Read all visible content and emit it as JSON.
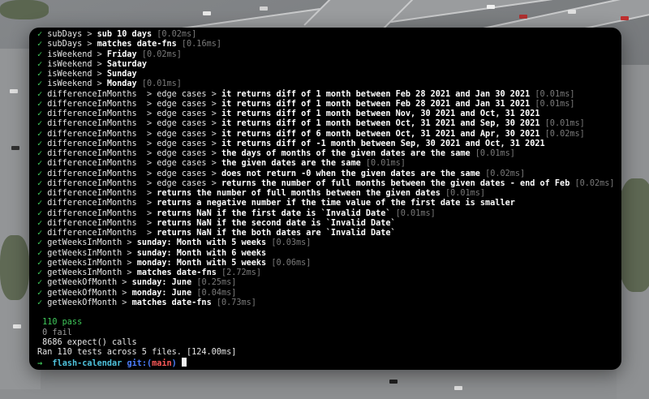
{
  "terminal": {
    "results": [
      {
        "name": "subDays",
        "parts": [
          "sub 10 days"
        ],
        "time": "[0.02ms]"
      },
      {
        "name": "subDays",
        "parts": [
          "matches date-fns"
        ],
        "time": "[0.16ms]"
      },
      {
        "name": "isWeekend",
        "parts": [
          "Friday"
        ],
        "time": "[0.02ms]"
      },
      {
        "name": "isWeekend",
        "parts": [
          "Saturday"
        ],
        "time": ""
      },
      {
        "name": "isWeekend",
        "parts": [
          "Sunday"
        ],
        "time": ""
      },
      {
        "name": "isWeekend",
        "parts": [
          "Monday"
        ],
        "time": "[0.01ms]"
      },
      {
        "name": "differenceInMonths ",
        "parts": [
          "edge cases",
          "it returns diff of 1 month between Feb 28 2021 and Jan 30 2021"
        ],
        "time": "[0.01ms]"
      },
      {
        "name": "differenceInMonths ",
        "parts": [
          "edge cases",
          "it returns diff of 1 month between Feb 28 2021 and Jan 31 2021"
        ],
        "time": "[0.01ms]"
      },
      {
        "name": "differenceInMonths ",
        "parts": [
          "edge cases",
          "it returns diff of 1 month between Nov, 30 2021 and Oct, 31 2021"
        ],
        "time": ""
      },
      {
        "name": "differenceInMonths ",
        "parts": [
          "edge cases",
          "it returns diff of 1 month between Oct, 31 2021 and Sep, 30 2021"
        ],
        "time": "[0.01ms]"
      },
      {
        "name": "differenceInMonths ",
        "parts": [
          "edge cases",
          "it returns diff of 6 month between Oct, 31 2021 and Apr, 30 2021"
        ],
        "time": "[0.02ms]"
      },
      {
        "name": "differenceInMonths ",
        "parts": [
          "edge cases",
          "it returns diff of -1 month between Sep, 30 2021 and Oct, 31 2021"
        ],
        "time": ""
      },
      {
        "name": "differenceInMonths ",
        "parts": [
          "edge cases",
          "the days of months of the given dates are the same"
        ],
        "time": "[0.01ms]"
      },
      {
        "name": "differenceInMonths ",
        "parts": [
          "edge cases",
          "the given dates are the same"
        ],
        "time": "[0.01ms]"
      },
      {
        "name": "differenceInMonths ",
        "parts": [
          "edge cases",
          "does not return -0 when the given dates are the same"
        ],
        "time": "[0.02ms]"
      },
      {
        "name": "differenceInMonths ",
        "parts": [
          "edge cases",
          "returns the number of full months between the given dates - end of Feb"
        ],
        "time": "[0.02ms]"
      },
      {
        "name": "differenceInMonths ",
        "parts": [
          "returns the number of full months between the given dates"
        ],
        "time": "[0.01ms]"
      },
      {
        "name": "differenceInMonths ",
        "parts": [
          "returns a negative number if the time value of the first date is smaller"
        ],
        "time": ""
      },
      {
        "name": "differenceInMonths ",
        "parts": [
          "returns NaN if the first date is `Invalid Date`"
        ],
        "time": "[0.01ms]"
      },
      {
        "name": "differenceInMonths ",
        "parts": [
          "returns NaN if the second date is `Invalid Date`"
        ],
        "time": ""
      },
      {
        "name": "differenceInMonths ",
        "parts": [
          "returns NaN if the both dates are `Invalid Date`"
        ],
        "time": ""
      },
      {
        "name": "getWeeksInMonth",
        "parts": [
          "sunday: Month with 5 weeks"
        ],
        "time": "[0.03ms]"
      },
      {
        "name": "getWeeksInMonth",
        "parts": [
          "sunday: Month with 6 weeks"
        ],
        "time": ""
      },
      {
        "name": "getWeeksInMonth",
        "parts": [
          "monday: Month with 5 weeks"
        ],
        "time": "[0.06ms]"
      },
      {
        "name": "getWeeksInMonth",
        "parts": [
          "matches date-fns"
        ],
        "time": "[2.72ms]"
      },
      {
        "name": "getWeekOfMonth",
        "parts": [
          "sunday: June"
        ],
        "time": "[0.25ms]"
      },
      {
        "name": "getWeekOfMonth",
        "parts": [
          "monday: June"
        ],
        "time": "[0.04ms]"
      },
      {
        "name": "getWeekOfMonth",
        "parts": [
          "matches date-fns"
        ],
        "time": "[0.73ms]"
      }
    ],
    "check_glyph": "✓",
    "separator": ">",
    "summary": {
      "pass": " 110 pass",
      "fail": " 0 fail",
      "expect": " 8686 expect() calls",
      "ran": "Ran 110 tests across 5 files. [124.00ms]"
    },
    "prompt": {
      "arrow": "→",
      "dir": "flash-calendar",
      "git_label": "git:(",
      "branch": "main",
      "git_close": ")"
    }
  },
  "colors": {
    "pass": "#3fc85a",
    "timing": "#7a7a7a",
    "prompt_dir": "#4fc3dd",
    "prompt_git": "#4d7fff",
    "branch": "#ff5a5a"
  }
}
